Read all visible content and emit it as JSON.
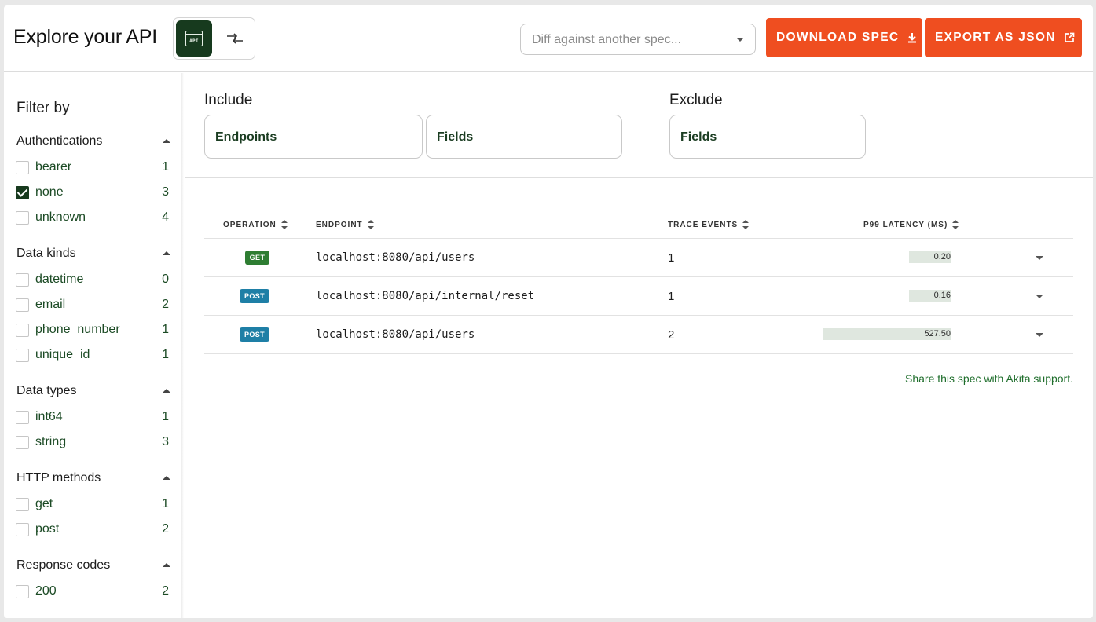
{
  "header": {
    "title": "Explore your API",
    "api_toggle_label": "API",
    "diff_placeholder": "Diff against another spec...",
    "download_label": "DOWNLOAD SPEC",
    "export_label": "EXPORT AS JSON"
  },
  "sidebar": {
    "title": "Filter by",
    "groups": [
      {
        "label": "Authentications",
        "options": [
          {
            "name": "bearer",
            "count": "1",
            "checked": false
          },
          {
            "name": "none",
            "count": "3",
            "checked": true
          },
          {
            "name": "unknown",
            "count": "4",
            "checked": false
          }
        ]
      },
      {
        "label": "Data kinds",
        "options": [
          {
            "name": "datetime",
            "count": "0",
            "checked": false
          },
          {
            "name": "email",
            "count": "2",
            "checked": false
          },
          {
            "name": "phone_number",
            "count": "1",
            "checked": false
          },
          {
            "name": "unique_id",
            "count": "1",
            "checked": false
          }
        ]
      },
      {
        "label": "Data types",
        "options": [
          {
            "name": "int64",
            "count": "1",
            "checked": false
          },
          {
            "name": "string",
            "count": "3",
            "checked": false
          }
        ]
      },
      {
        "label": "HTTP methods",
        "options": [
          {
            "name": "get",
            "count": "1",
            "checked": false
          },
          {
            "name": "post",
            "count": "2",
            "checked": false
          }
        ]
      },
      {
        "label": "Response codes",
        "options": [
          {
            "name": "200",
            "count": "2",
            "checked": false
          }
        ]
      }
    ]
  },
  "filters": {
    "include_label": "Include",
    "exclude_label": "Exclude",
    "include_endpoints": "Endpoints",
    "include_fields": "Fields",
    "exclude_fields": "Fields"
  },
  "table": {
    "columns": [
      "OPERATION",
      "ENDPOINT",
      "TRACE EVENTS",
      "P99 LATENCY (MS)"
    ],
    "rows": [
      {
        "method": "GET",
        "method_color": "#2e7d32",
        "endpoint": "localhost:8080/api/users",
        "trace_events": "1",
        "latency": "0.20",
        "latency_fraction": 0.33
      },
      {
        "method": "POST",
        "method_color": "#1e7fa6",
        "endpoint": "localhost:8080/api/internal/reset",
        "trace_events": "1",
        "latency": "0.16",
        "latency_fraction": 0.33
      },
      {
        "method": "POST",
        "method_color": "#1e7fa6",
        "endpoint": "localhost:8080/api/users",
        "trace_events": "2",
        "latency": "527.50",
        "latency_fraction": 1.0
      }
    ]
  },
  "share_link": "Share this spec with Akita support.",
  "colors": {
    "accent": "#ef4e20",
    "dark_green": "#173a1e",
    "link_green": "#1f6e2c"
  }
}
